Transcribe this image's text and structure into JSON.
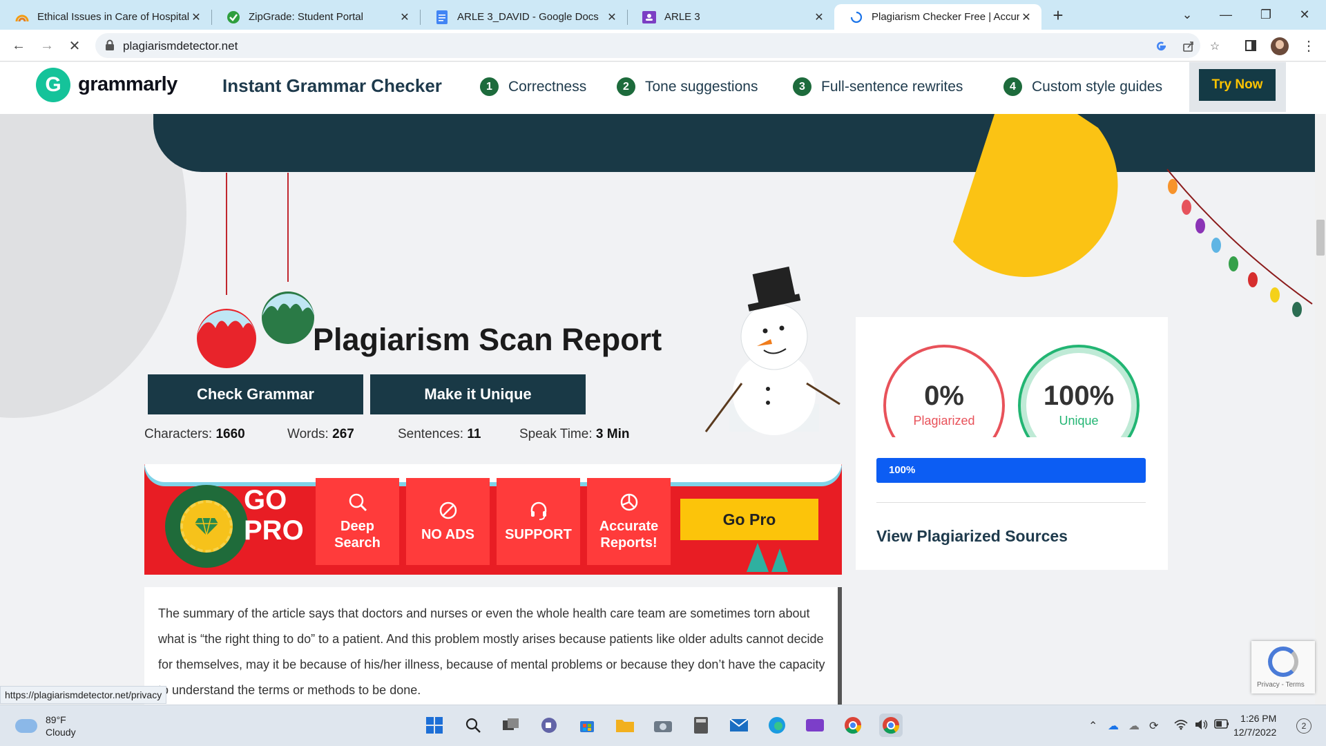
{
  "browser": {
    "tabs": [
      {
        "title": "Ethical Issues in Care of Hospitali",
        "icon": "rainbow-icon",
        "active": false
      },
      {
        "title": "ZipGrade: Student Portal",
        "icon": "check-circle-icon",
        "active": false
      },
      {
        "title": "ARLE 3_DAVID - Google Docs",
        "icon": "docs-icon",
        "active": false
      },
      {
        "title": "ARLE 3",
        "icon": "classroom-icon",
        "active": false
      },
      {
        "title": "Plagiarism Checker Free | Accurat",
        "icon": "loading-icon",
        "active": true
      }
    ],
    "url": "plagiarismdetector.net",
    "status_link": "https://plagiarismdetector.net/privacy"
  },
  "grammarly": {
    "brand": "grammarly",
    "headline": "Instant Grammar Checker",
    "features": [
      {
        "num": "1",
        "label": "Correctness"
      },
      {
        "num": "2",
        "label": "Tone suggestions"
      },
      {
        "num": "3",
        "label": "Full-sentence rewrites"
      },
      {
        "num": "4",
        "label": "Custom style guides"
      }
    ],
    "cta": "Try Now",
    "colors": {
      "brand": "#15c39a",
      "cta_text": "#ffc400",
      "cta_bg": "#143a45"
    }
  },
  "report": {
    "title": "Plagiarism Scan Report",
    "buttons": {
      "check_grammar": "Check Grammar",
      "make_unique": "Make it Unique"
    },
    "stats": {
      "characters_label": "Characters:",
      "characters": "1660",
      "words_label": "Words:",
      "words": "267",
      "sentences_label": "Sentences:",
      "sentences": "11",
      "speak_label": "Speak Time:",
      "speak": "3 Min"
    },
    "text": "The summary of the article says that doctors and nurses or even the whole health care team are sometimes torn about what is “the right thing to do” to a patient. And this problem mostly arises because patients like older adults cannot decide for themselves, may it be because of his/her illness, because of mental problems or because they don’t have the capacity to understand the terms or methods to be done."
  },
  "promo": {
    "go_pro_line1": "GO",
    "go_pro_line2": "PRO",
    "features": [
      {
        "line1": "Deep",
        "line2": "Search",
        "icon": "search-icon"
      },
      {
        "line1": "NO ADS",
        "line2": "",
        "icon": "no-ads-icon"
      },
      {
        "line1": "SUPPORT",
        "line2": "",
        "icon": "headset-icon"
      },
      {
        "line1": "Accurate",
        "line2": "Reports!",
        "icon": "pie-chart-icon"
      }
    ],
    "button": "Go Pro"
  },
  "result": {
    "plagiarized_pct": "0%",
    "plagiarized_label": "Plagiarized",
    "unique_pct": "100%",
    "unique_label": "Unique",
    "progress_label": "100%",
    "progress_fraction": 1.0,
    "sources_link": "View Plagiarized Sources",
    "colors": {
      "plagiarized": "#e8525a",
      "unique": "#22b573",
      "progress": "#0c5df3"
    }
  },
  "recaptcha": {
    "links": "Privacy - Terms"
  },
  "taskbar": {
    "weather_temp": "89°F",
    "weather_desc": "Cloudy",
    "time": "1:26 PM",
    "date": "12/7/2022",
    "notifications": "2"
  }
}
